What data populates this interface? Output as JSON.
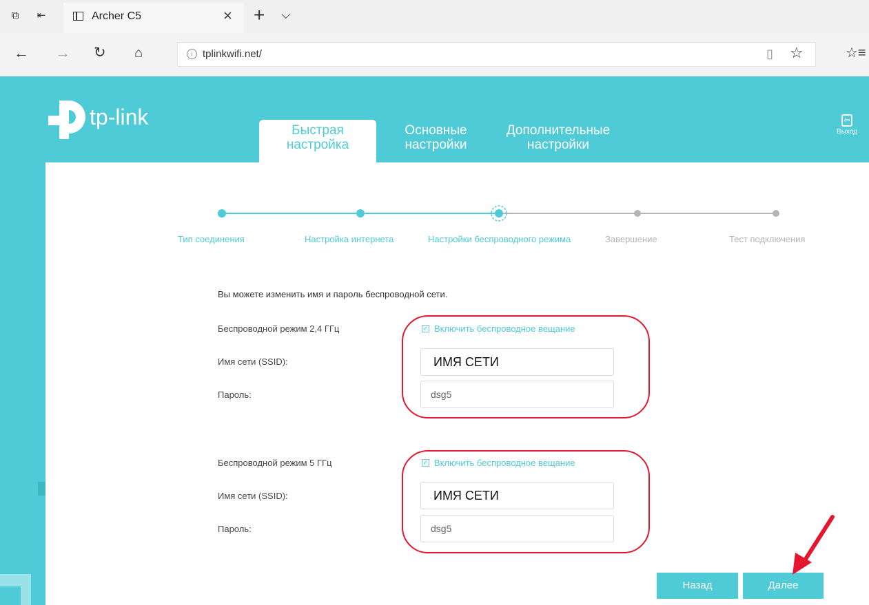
{
  "browser": {
    "tab_title": "Archer C5",
    "url": "tplinkwifi.net/"
  },
  "router": {
    "brand": "tp-link",
    "nav": {
      "quick_setup": [
        "Быстрая",
        "настройка"
      ],
      "basic": [
        "Основные",
        "настройки"
      ],
      "advanced": [
        "Дополнительные",
        "настройки"
      ]
    },
    "logout": "Выход",
    "steps": [
      {
        "label": "Тип соединения",
        "state": "done"
      },
      {
        "label": "Настройка интернета",
        "state": "done"
      },
      {
        "label": "Настройки беспроводного режима",
        "state": "current"
      },
      {
        "label": "Завершение",
        "state": "pending"
      },
      {
        "label": "Тест подключения",
        "state": "pending"
      }
    ],
    "intro": "Вы можете изменить имя и пароль беспроводной сети.",
    "band_24": {
      "title": "Беспроводной режим 2,4 ГГц",
      "enable_label": "Включить беспроводное вещание",
      "ssid_label": "Имя сети (SSID):",
      "ssid_value": "ИМЯ СЕТИ",
      "password_label": "Пароль:",
      "password_value": "dsg5"
    },
    "band_5": {
      "title": "Беспроводной режим 5 ГГц",
      "enable_label": "Включить беспроводное вещание",
      "ssid_label": "Имя сети (SSID):",
      "ssid_value": "ИМЯ СЕТИ",
      "password_label": "Пароль:",
      "password_value": "dsg5"
    },
    "buttons": {
      "back": "Назад",
      "next": "Далее"
    }
  },
  "colors": {
    "brand": "#4ecbd6",
    "inactive": "#b5b5b5",
    "annotation": "#e3172f"
  }
}
